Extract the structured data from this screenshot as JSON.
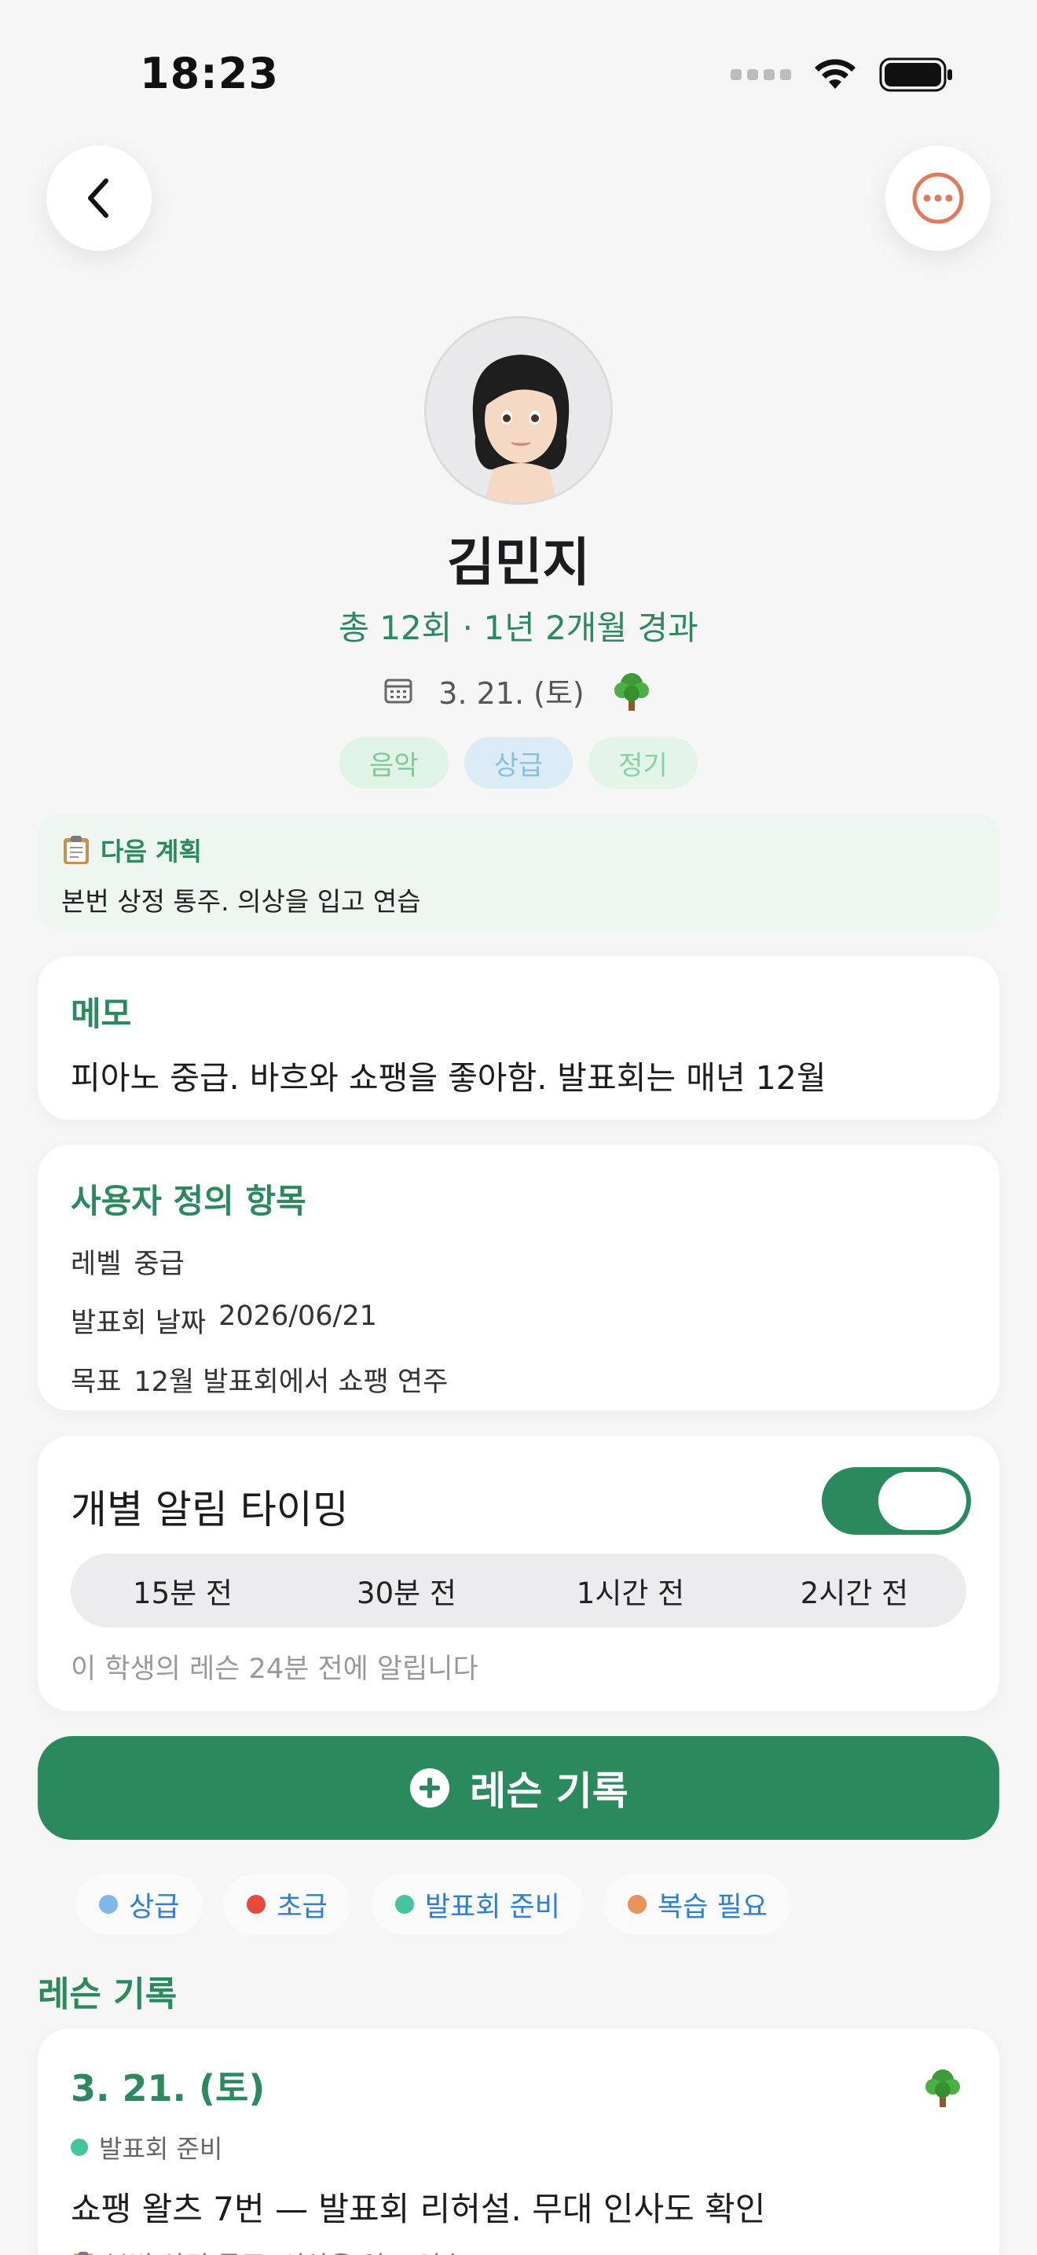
{
  "status_bar": {
    "time": "18:23"
  },
  "header": {
    "back_icon": "chevron-left-icon",
    "more_icon": "ellipsis-circle-icon",
    "accent": "#e07a5f"
  },
  "profile": {
    "name": "김민지",
    "summary": "총 12회 · 1년 2개월 경과",
    "last_date": "3. 21. (토)",
    "tags": [
      "음악",
      "상급",
      "정기"
    ]
  },
  "next_plan": {
    "title": "다음 계획",
    "body": "본번 상정 통주. 의상을 입고 연습"
  },
  "memo": {
    "title": "메모",
    "body": "피아노 중급. 바흐와 쇼팽을 좋아함. 발표회는 매년 12월"
  },
  "custom_fields": {
    "title": "사용자 정의 항목",
    "items": [
      {
        "key": "레벨",
        "value": "중급"
      },
      {
        "key": "발표회 날짜",
        "value": "2026/06/21"
      },
      {
        "key": "목표",
        "value": "12월 발표회에서 쇼팽 연주"
      }
    ]
  },
  "notify": {
    "title": "개별 알림 타이밍",
    "enabled": true,
    "options": [
      "15분 전",
      "30분 전",
      "1시간 전",
      "2시간 전"
    ],
    "hint": "이 학생의 레슨 24분 전에 알립니다"
  },
  "record_button": {
    "label": "레슨 기록",
    "icon": "plus-circle-icon"
  },
  "filter_tags": [
    {
      "label": "상급",
      "color": "#7fb8e8"
    },
    {
      "label": "초급",
      "color": "#e64a3b"
    },
    {
      "label": "발표회 준비",
      "color": "#45c4a0"
    },
    {
      "label": "복습 필요",
      "color": "#e8935a"
    }
  ],
  "lessons_section": {
    "title": "레슨 기록"
  },
  "lessons": [
    {
      "date": "3. 21. (토)",
      "tag": "발표회 준비",
      "tag_color": "#45c4a0",
      "text": "쇼팽 왈츠 7번 — 발표회 리허설. 무대 인사도 확인",
      "sub": "본번 상정 통주. 의상을 입고 연습"
    }
  ],
  "colors": {
    "primary": "#2a8a5d",
    "background": "#f6f6f6"
  }
}
